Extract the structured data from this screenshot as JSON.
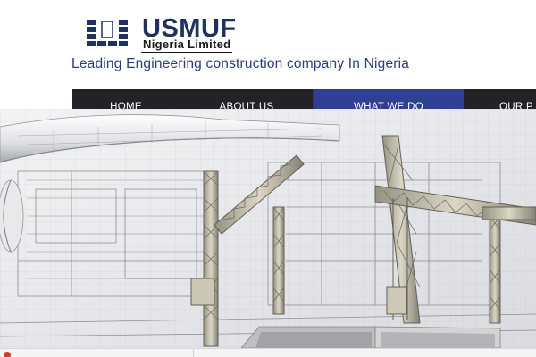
{
  "brand": {
    "name": "USMUF",
    "subtitle": "Nigeria Limited",
    "tagline": "Leading Engineering construction company In Nigeria",
    "primary_color": "#1f3160"
  },
  "nav": {
    "items": [
      {
        "label": "HOME"
      },
      {
        "label": "ABOUT US"
      },
      {
        "label": "WHAT WE DO",
        "active": true
      },
      {
        "label": "OUR P"
      }
    ],
    "background": "#222326",
    "active_color": "#2f3f91"
  },
  "hero": {
    "image": "construction-blueprint-with-cranes"
  }
}
